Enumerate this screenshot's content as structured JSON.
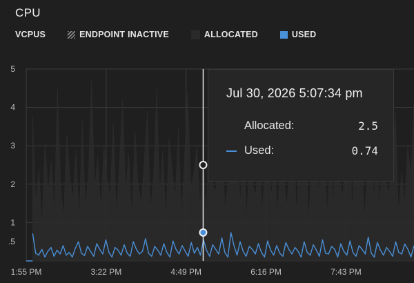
{
  "title": "CPU",
  "legend": {
    "unit_label": "VCPUS",
    "items": [
      {
        "label": "ENDPOINT INACTIVE",
        "icon": "hatched-square-icon"
      },
      {
        "label": "ALLOCATED",
        "color": "#2a2a2a"
      },
      {
        "label": "USED",
        "color": "#4a90d9"
      }
    ]
  },
  "tooltip": {
    "datetime": "Jul 30, 2026 5:07:34 pm",
    "rows": [
      {
        "label": "Allocated:",
        "value": "2.5"
      },
      {
        "label": "Used:",
        "value": "0.74"
      }
    ]
  },
  "colors": {
    "background": "#1f1f1f",
    "used": "#4a90d9",
    "allocated": "#2b2b2b",
    "grid": "#3c3c3c",
    "cursor": "#e8e8e8"
  },
  "chart_data": {
    "type": "line",
    "title": "CPU",
    "ylabel": "VCPUS",
    "ylim": [
      0,
      5
    ],
    "yticks": [
      {
        "value": 0.5,
        "label": ".5"
      },
      {
        "value": 1,
        "label": "1"
      },
      {
        "value": 2,
        "label": "2"
      },
      {
        "value": 3,
        "label": "3"
      },
      {
        "value": 4,
        "label": "4"
      },
      {
        "value": 5,
        "label": "5"
      }
    ],
    "xticks": [
      "1:55 PM",
      "3:22 PM",
      "4:49 PM",
      "6:16 PM",
      "7:43 PM"
    ],
    "xrange": [
      "1:55 PM",
      "8:57 PM"
    ],
    "cursor": {
      "time": "5:07:34 PM",
      "allocated": 2.5,
      "used": 0.74
    },
    "series": [
      {
        "name": "USED",
        "samples_start": "2:02 PM",
        "samples_end": "8:57 PM",
        "values": [
          0.72,
          0.2,
          0.15,
          0.3,
          0.1,
          0.25,
          0.35,
          0.12,
          0.28,
          0.18,
          0.4,
          0.15,
          0.22,
          0.1,
          0.33,
          0.5,
          0.2,
          0.14,
          0.38,
          0.25,
          0.12,
          0.45,
          0.3,
          0.18,
          0.55,
          0.22,
          0.1,
          0.35,
          0.28,
          0.15,
          0.42,
          0.2,
          0.12,
          0.5,
          0.3,
          0.18,
          0.25,
          0.58,
          0.2,
          0.12,
          0.38,
          0.28,
          0.15,
          0.45,
          0.22,
          0.1,
          0.52,
          0.3,
          0.18,
          0.4,
          0.25,
          0.12,
          0.48,
          0.2,
          0.35,
          0.15,
          0.55,
          0.28,
          0.12,
          0.42,
          0.3,
          0.18,
          0.6,
          0.22,
          0.1,
          0.74,
          0.4,
          0.15,
          0.5,
          0.25,
          0.12,
          0.38,
          0.3,
          0.18,
          0.45,
          0.22,
          0.1,
          0.52,
          0.28,
          0.15,
          0.4,
          0.2,
          0.12,
          0.48,
          0.3,
          0.18,
          0.35,
          0.25,
          0.1,
          0.5,
          0.22,
          0.15,
          0.42,
          0.28,
          0.12,
          0.55,
          0.2,
          0.18,
          0.38,
          0.3,
          0.1,
          0.45,
          0.25,
          0.15,
          0.52,
          0.22,
          0.12,
          0.4,
          0.3,
          0.18,
          0.62,
          0.2,
          0.1,
          0.48,
          0.28,
          0.15,
          0.35,
          0.25,
          0.12,
          0.5,
          0.22,
          0.18,
          0.44,
          0.3,
          0.1,
          0.4
        ]
      },
      {
        "name": "ALLOCATED",
        "samples_start": "2:02 PM",
        "samples_end": "8:57 PM",
        "values": [
          3.8,
          1.5,
          2.4,
          0.9,
          3.1,
          1.8,
          2.6,
          1.2,
          4.5,
          2.0,
          1.1,
          3.3,
          2.2,
          1.6,
          2.9,
          1.0,
          3.7,
          1.4,
          2.3,
          4.7,
          1.9,
          2.7,
          1.3,
          3.0,
          2.1,
          1.7,
          3.6,
          1.2,
          2.5,
          4.2,
          1.8,
          2.8,
          1.1,
          3.4,
          2.0,
          1.5,
          2.6,
          3.9,
          1.3,
          2.2,
          4.5,
          1.7,
          2.9,
          1.0,
          3.2,
          2.4,
          1.6,
          3.5,
          1.2,
          2.7,
          4.4,
          1.9,
          2.3,
          3.0,
          1.4,
          2.8,
          1.1,
          3.6,
          2.0,
          1.8,
          2.5,
          3.7,
          1.3,
          2.1,
          4.8,
          2.5,
          2.6,
          1.5,
          3.3,
          1.0,
          2.9,
          2.0,
          1.7,
          3.4,
          1.2,
          2.6,
          4.0,
          1.6,
          2.8,
          1.1,
          3.1,
          2.2,
          1.4,
          2.7,
          3.8,
          1.3,
          2.4,
          1.9,
          3.5,
          1.0,
          2.6,
          4.3,
          1.8,
          2.2,
          3.0,
          1.2,
          2.9,
          1.5,
          3.6,
          2.1,
          1.7,
          2.5,
          4.1,
          1.3,
          2.8,
          1.9,
          3.2,
          1.1,
          2.4,
          3.7,
          1.6,
          2.7,
          1.4,
          3.3,
          2.0,
          1.8,
          2.6,
          3.9,
          1.2,
          2.3,
          1.5,
          3.0,
          2.2,
          4.2
        ]
      }
    ]
  }
}
